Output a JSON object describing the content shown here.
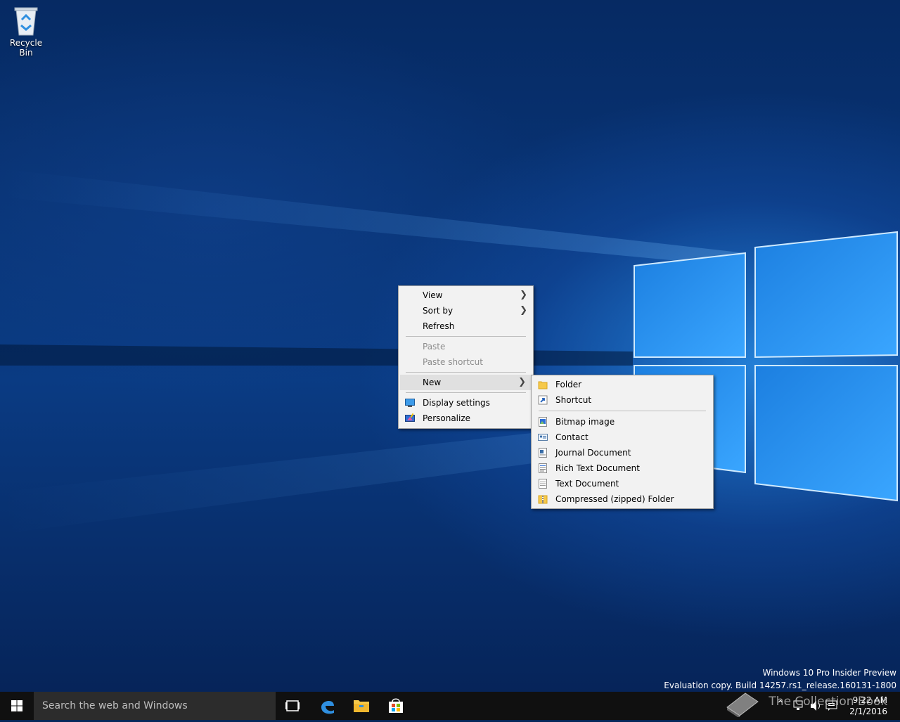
{
  "desktop": {
    "recycle_bin_label": "Recycle Bin"
  },
  "context_menu": {
    "items": [
      {
        "label": "View",
        "submenu": true,
        "enabled": true
      },
      {
        "label": "Sort by",
        "submenu": true,
        "enabled": true
      },
      {
        "label": "Refresh",
        "submenu": false,
        "enabled": true
      },
      {
        "label": "Paste",
        "enabled": false
      },
      {
        "label": "Paste shortcut",
        "enabled": false
      },
      {
        "label": "New",
        "submenu": true,
        "enabled": true,
        "highlighted": true
      },
      {
        "label": "Display settings",
        "icon": "display-icon"
      },
      {
        "label": "Personalize",
        "icon": "personalize-icon"
      }
    ]
  },
  "new_submenu": {
    "items": [
      {
        "label": "Folder",
        "icon": "folder-icon"
      },
      {
        "label": "Shortcut",
        "icon": "shortcut-icon"
      },
      {
        "label": "Bitmap image",
        "icon": "bitmap-icon"
      },
      {
        "label": "Contact",
        "icon": "contact-icon"
      },
      {
        "label": "Journal Document",
        "icon": "journal-icon"
      },
      {
        "label": "Rich Text Document",
        "icon": "rich-text-icon"
      },
      {
        "label": "Text Document",
        "icon": "text-document-icon"
      },
      {
        "label": "Compressed (zipped) Folder",
        "icon": "zip-folder-icon"
      }
    ]
  },
  "watermark": {
    "line1": "Windows 10 Pro Insider Preview",
    "line2": "Evaluation copy. Build 14257.rs1_release.160131-1800",
    "site_text": "The Collection Book"
  },
  "taskbar": {
    "search_placeholder": "Search the web and Windows",
    "time": "9:22 AM",
    "date": "2/1/2016"
  },
  "colors": {
    "accent": "#1e6fd0",
    "taskbar": "#101010",
    "menu_bg": "#f2f2f2"
  }
}
